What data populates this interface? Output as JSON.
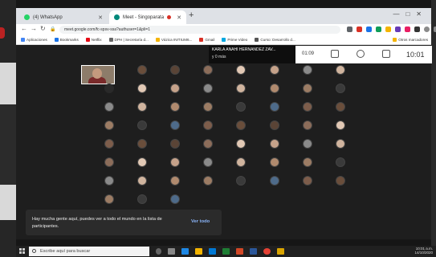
{
  "browser": {
    "tabs": [
      {
        "label": "(4) WhatsApp",
        "fav_color": "#25d366"
      },
      {
        "label": "Meet - Singoparata",
        "fav_color": "#00897b"
      }
    ],
    "new_tab": "+",
    "address": "meet.google.com/fc-spsv-ssa?authuser=1&pli=1",
    "bookmarks": [
      {
        "label": "Aplicaciones",
        "color": "#4285f4"
      },
      {
        "label": "Bookmarks",
        "color": "#1a73e8"
      },
      {
        "label": "Netflix",
        "color": "#e50914"
      },
      {
        "label": "DPH | Secretaría d...",
        "color": "#666"
      },
      {
        "label": "Vázica INITIUM6...",
        "color": "#f4b400"
      },
      {
        "label": "Gmail",
        "color": "#d93025"
      },
      {
        "label": "Prime Video",
        "color": "#00a8e1"
      },
      {
        "label": "Curso: Desarrollo d...",
        "color": "#555"
      },
      {
        "label": "Otros marcadores",
        "color": "#f4b400"
      }
    ]
  },
  "meet": {
    "speaker_name": "KARLA ANAHI HERNANDEZ ZAV...",
    "speaker_more": "y 0 más",
    "timer": "01:09",
    "clock": "10:01",
    "notice": {
      "message": "Hay mucha gente aquí, puedes ver a todo el mundo en la lista de participantes.",
      "button": "Ver todo"
    },
    "avatar_colors": [
      "#6a4e3b",
      "#b08a6e",
      "#8c6d5a",
      "#3a3a3a",
      "#c5a28a",
      "#7d5d4b",
      "#d0b49e",
      "#5a4436",
      "#9c7c64",
      "#e2c9b5",
      "#4e6b8a",
      "#8a8a8a"
    ]
  },
  "taskbar": {
    "search_placeholder": "Escribe aquí para buscar",
    "tray_time": "10:01 a.m.",
    "tray_date": "14/10/2020"
  }
}
